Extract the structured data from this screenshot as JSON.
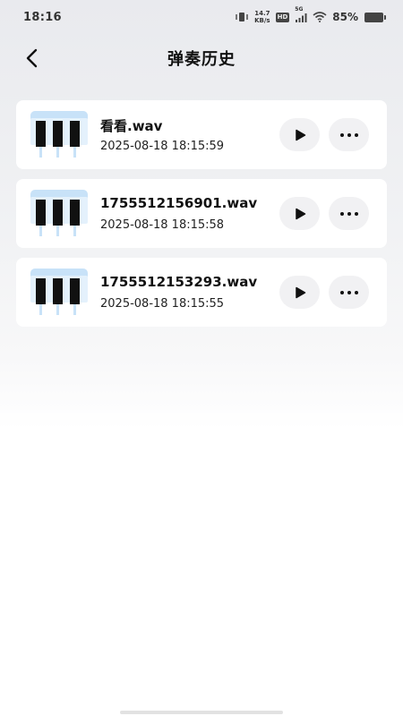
{
  "status_bar": {
    "time": "18:16",
    "net_speed_value": "14.7",
    "net_speed_unit": "KB/s",
    "hd_label": "HD",
    "signal_label": "5G",
    "battery_percent": "85%"
  },
  "header": {
    "title": "弹奏历史"
  },
  "records": [
    {
      "name": "看看.wav",
      "datetime": "2025-08-18 18:15:59"
    },
    {
      "name": "1755512156901.wav",
      "datetime": "2025-08-18 18:15:58"
    },
    {
      "name": "1755512153293.wav",
      "datetime": "2025-08-18 18:15:55"
    }
  ],
  "icons": {
    "back": "chevron-left-icon",
    "play": "play-icon",
    "more": "more-horizontal-icon",
    "thumbnail": "piano-keys-icon"
  },
  "colors": {
    "accent_light_blue": "#c8e2f8",
    "key_black": "#111111",
    "button_bg": "#f1f1f3"
  }
}
